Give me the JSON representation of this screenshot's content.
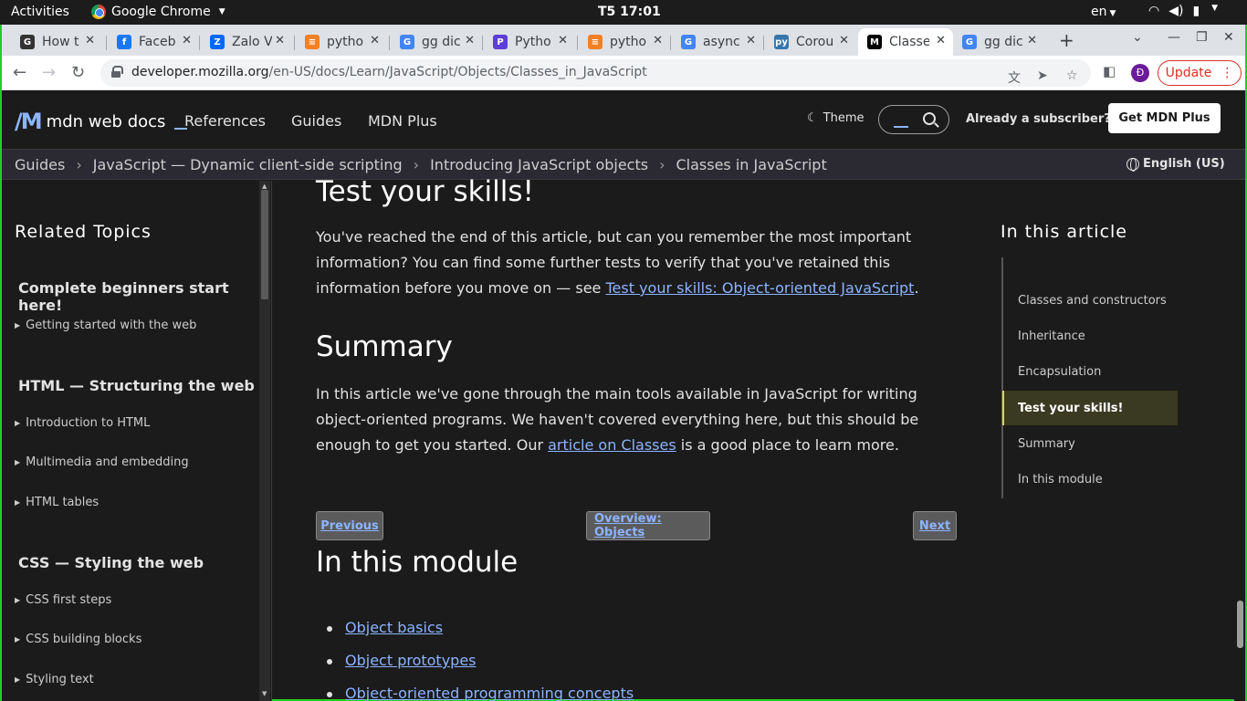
{
  "desktop": {
    "activities": "Activities",
    "app_name": "Google Chrome",
    "clock": "T5 17:01",
    "input_lang": "en"
  },
  "tabs": [
    {
      "title": "How t",
      "favicon": "G",
      "color": "#333"
    },
    {
      "title": "Faceb",
      "favicon": "f",
      "color": "#1877f2"
    },
    {
      "title": "Zalo V",
      "favicon": "Z",
      "color": "#0068ff"
    },
    {
      "title": "pytho",
      "favicon": "≡",
      "color": "#f48024"
    },
    {
      "title": "gg dic",
      "favicon": "G",
      "color": "#4285f4"
    },
    {
      "title": "Pytho",
      "favicon": "P",
      "color": "#5b3fd6"
    },
    {
      "title": "pytho",
      "favicon": "≡",
      "color": "#f48024"
    },
    {
      "title": "async",
      "favicon": "G",
      "color": "#4285f4"
    },
    {
      "title": "Corou",
      "favicon": "py",
      "color": "#3776ab"
    },
    {
      "title": "Classe",
      "favicon": "M",
      "color": "#000"
    },
    {
      "title": "gg dic",
      "favicon": "G",
      "color": "#4285f4"
    }
  ],
  "address": {
    "host": "developer.mozilla.org",
    "path": "/en-US/docs/Learn/JavaScript/Objects/Classes_in_JavaScript",
    "profile_initial": "Đ",
    "update_label": "Update"
  },
  "mdn": {
    "logo_text": "mdn web docs",
    "nav": [
      "References",
      "Guides",
      "MDN Plus"
    ],
    "theme_label": "Theme",
    "subscriber_label": "Already a subscriber?",
    "get_plus_label": "Get MDN Plus",
    "language": "English (US)"
  },
  "breadcrumbs": [
    "Guides",
    "JavaScript — Dynamic client-side scripting",
    "Introducing JavaScript objects",
    "Classes in JavaScript"
  ],
  "sidebar": {
    "title": "Related Topics",
    "sections": [
      {
        "heading": "Complete beginners start here!",
        "items": [
          "Getting started with the web"
        ]
      },
      {
        "heading": "HTML — Structuring the web",
        "items": [
          "Introduction to HTML",
          "Multimedia and embedding",
          "HTML tables"
        ]
      },
      {
        "heading": "CSS — Styling the web",
        "items": [
          "CSS first steps",
          "CSS building blocks",
          "Styling text"
        ]
      }
    ]
  },
  "content": {
    "test_heading": "Test your skills!",
    "test_para_before": "You've reached the end of this article, but can you remember the most important information? You can find some further tests to verify that you've retained this information before you move on — see ",
    "test_link": "Test your skills: Object-oriented JavaScript",
    "test_para_after": ".",
    "summary_heading": "Summary",
    "summary_para_before": "In this article we've gone through the main tools available in JavaScript for writing object-oriented programs. We haven't covered everything here, but this should be enough to get you started. Our ",
    "summary_link": "article on Classes",
    "summary_para_after": " is a good place to learn more.",
    "pager_previous": "Previous",
    "pager_overview": "Overview: Objects",
    "pager_next": "Next",
    "module_heading": "In this module",
    "module_links": [
      "Object basics",
      "Object prototypes",
      "Object-oriented programming concepts"
    ]
  },
  "toc": {
    "title": "In this article",
    "items": [
      "Classes and constructors",
      "Inheritance",
      "Encapsulation",
      "Test your skills!",
      "Summary",
      "In this module"
    ],
    "current_index": 3
  }
}
